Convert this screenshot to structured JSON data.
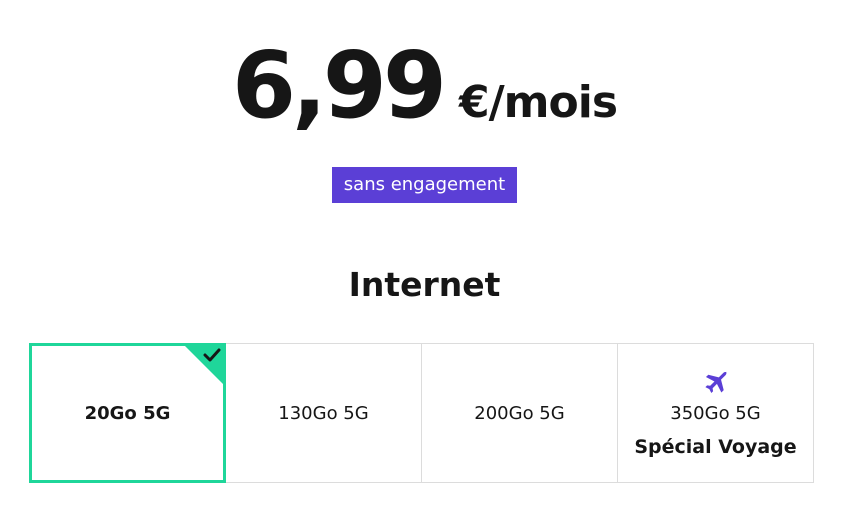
{
  "price": {
    "amount": "6,99",
    "unit": "€/mois"
  },
  "badge": {
    "label": "sans engagement"
  },
  "section": {
    "title": "Internet"
  },
  "options": [
    {
      "label": "20Go 5G",
      "sub": "",
      "selected": true,
      "icon": "check-icon"
    },
    {
      "label": "130Go 5G",
      "sub": "",
      "selected": false
    },
    {
      "label": "200Go 5G",
      "sub": "",
      "selected": false
    },
    {
      "label": "350Go 5G",
      "sub": "Spécial Voyage",
      "selected": false,
      "icon": "airplane-icon"
    }
  ],
  "colors": {
    "accent_purple": "#5b3fd6",
    "selected_green": "#1fd69a",
    "border_gray": "#dcdcdc",
    "text": "#161616"
  }
}
